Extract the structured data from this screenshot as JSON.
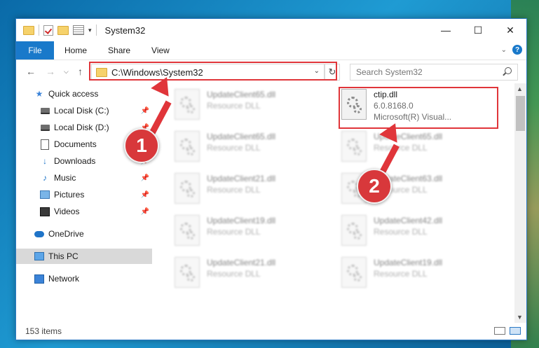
{
  "window": {
    "title": "System32"
  },
  "ribbon": {
    "tabs": [
      "File",
      "Home",
      "Share",
      "View"
    ]
  },
  "nav": {
    "address": "C:\\Windows\\System32",
    "search_placeholder": "Search System32"
  },
  "sidebar": {
    "items": [
      {
        "label": "Quick access",
        "icon": "star-icon",
        "pinned": false
      },
      {
        "label": "Local Disk (C:)",
        "icon": "disk-icon",
        "pinned": true
      },
      {
        "label": "Local Disk (D:)",
        "icon": "disk-icon",
        "pinned": true
      },
      {
        "label": "Documents",
        "icon": "documents-icon",
        "pinned": true
      },
      {
        "label": "Downloads",
        "icon": "downloads-icon",
        "pinned": true
      },
      {
        "label": "Music",
        "icon": "music-icon",
        "pinned": true
      },
      {
        "label": "Pictures",
        "icon": "pictures-icon",
        "pinned": true
      },
      {
        "label": "Videos",
        "icon": "videos-icon",
        "pinned": true
      },
      {
        "label": "OneDrive",
        "icon": "onedrive-icon",
        "pinned": false
      },
      {
        "label": "This PC",
        "icon": "this-pc-icon",
        "pinned": false,
        "selected": true
      },
      {
        "label": "Network",
        "icon": "network-icon",
        "pinned": false
      }
    ]
  },
  "files": [
    {
      "name": "UpdateClient65.dll",
      "sub": "Resource DLL"
    },
    {
      "name": "ctip.dll",
      "sub": "6.0.8168.0",
      "sub2": "Microsoft(R) Visual..."
    },
    {
      "name": "UpdateClient65.dll",
      "sub": "Resource DLL"
    },
    {
      "name": "UpdateClient65.dll",
      "sub": "Resource DLL"
    },
    {
      "name": "UpdateClient21.dll",
      "sub": "Resource DLL"
    },
    {
      "name": "UpdateClient63.dll",
      "sub": "Resource DLL"
    },
    {
      "name": "UpdateClient19.dll",
      "sub": "Resource DLL"
    },
    {
      "name": "UpdateClient42.dll",
      "sub": "Resource DLL"
    },
    {
      "name": "UpdateClient21.dll",
      "sub": "Resource DLL"
    },
    {
      "name": "UpdateClient19.dll",
      "sub": "Resource DLL"
    }
  ],
  "status": {
    "item_count": "153 items"
  },
  "annotations": {
    "step1": "1",
    "step2": "2"
  },
  "colors": {
    "accent": "#1979ca",
    "highlight": "#e0353a"
  }
}
